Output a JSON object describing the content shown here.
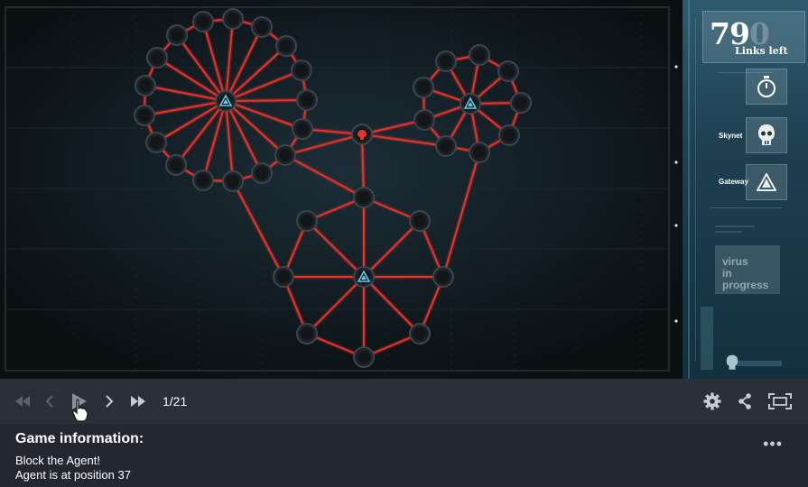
{
  "hud": {
    "links_left_value": "79",
    "links_left_faded_digit": "0",
    "links_left_label": "Links left",
    "skynet_label": "Skynet",
    "gateway_label": "Gateway",
    "virus_line1": "virus",
    "virus_line2": "in progress"
  },
  "player": {
    "frame": "1/21",
    "buttons": [
      "first-frame",
      "previous-frame",
      "play",
      "next-frame",
      "last-frame"
    ]
  },
  "toolbar_icons": [
    "settings-icon",
    "share-icon",
    "fullscreen-icon"
  ],
  "info": {
    "title": "Game information:",
    "line1": "Block the Agent!",
    "line2": "Agent is at position 37",
    "more": "•••"
  },
  "colors": {
    "link": "#e8332a",
    "node": "#1c2126",
    "gateway": "#5fd0ef",
    "agent": "#e8332a",
    "panel": "#2a3038"
  }
}
